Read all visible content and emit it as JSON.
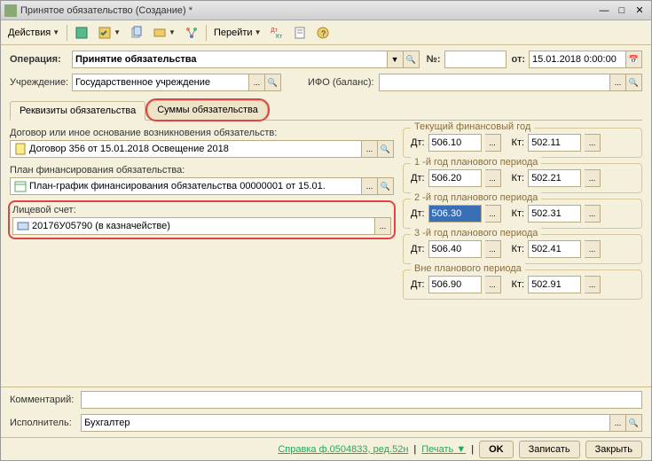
{
  "window": {
    "title": "Принятое обязательство (Создание) *"
  },
  "toolbar": {
    "actions": "Действия",
    "goto": "Перейти"
  },
  "header": {
    "operation_label": "Операция:",
    "operation_value": "Принятие обязательства",
    "number_label": "№:",
    "number_value": "",
    "from_label": "от:",
    "date_value": "15.01.2018 0:00:00",
    "org_label": "Учреждение:",
    "org_value": "Государственное учреждение",
    "ifo_label": "ИФО (баланс):",
    "ifo_value": ""
  },
  "tabs": {
    "t1": "Реквизиты обязательства",
    "t2": "Суммы обязательства"
  },
  "left": {
    "contract_label": "Договор или иное основание возникновения обязательств:",
    "contract_value": "Договор 356 от 15.01.2018 Освещение 2018",
    "plan_label": "План финансирования обязательства:",
    "plan_value": "План-график финансирования обязательства 00000001 от 15.01.",
    "account_label": "Лицевой счет:",
    "account_value": "20176У05790 (в казначействе)"
  },
  "groups": {
    "g1": {
      "title": "Текущий финансовый год",
      "dt": "506.10",
      "kt": "502.11"
    },
    "g2": {
      "title": "1 -й год планового периода",
      "dt": "506.20",
      "kt": "502.21"
    },
    "g3": {
      "title": "2 -й год планового периода",
      "dt": "506.30",
      "kt": "502.31"
    },
    "g4": {
      "title": "3 -й год планового периода",
      "dt": "506.40",
      "kt": "502.41"
    },
    "g5": {
      "title": "Вне планового периода",
      "dt": "506.90",
      "kt": "502.91"
    },
    "dt_label": "Дт:",
    "kt_label": "Кт:"
  },
  "bottom": {
    "comment_label": "Комментарий:",
    "comment_value": "",
    "executor_label": "Исполнитель:",
    "executor_value": "Бухгалтер"
  },
  "footer": {
    "help": "Справка ф.0504833, ред.52н",
    "print": "Печать",
    "ok": "OK",
    "save": "Записать",
    "close": "Закрыть"
  }
}
